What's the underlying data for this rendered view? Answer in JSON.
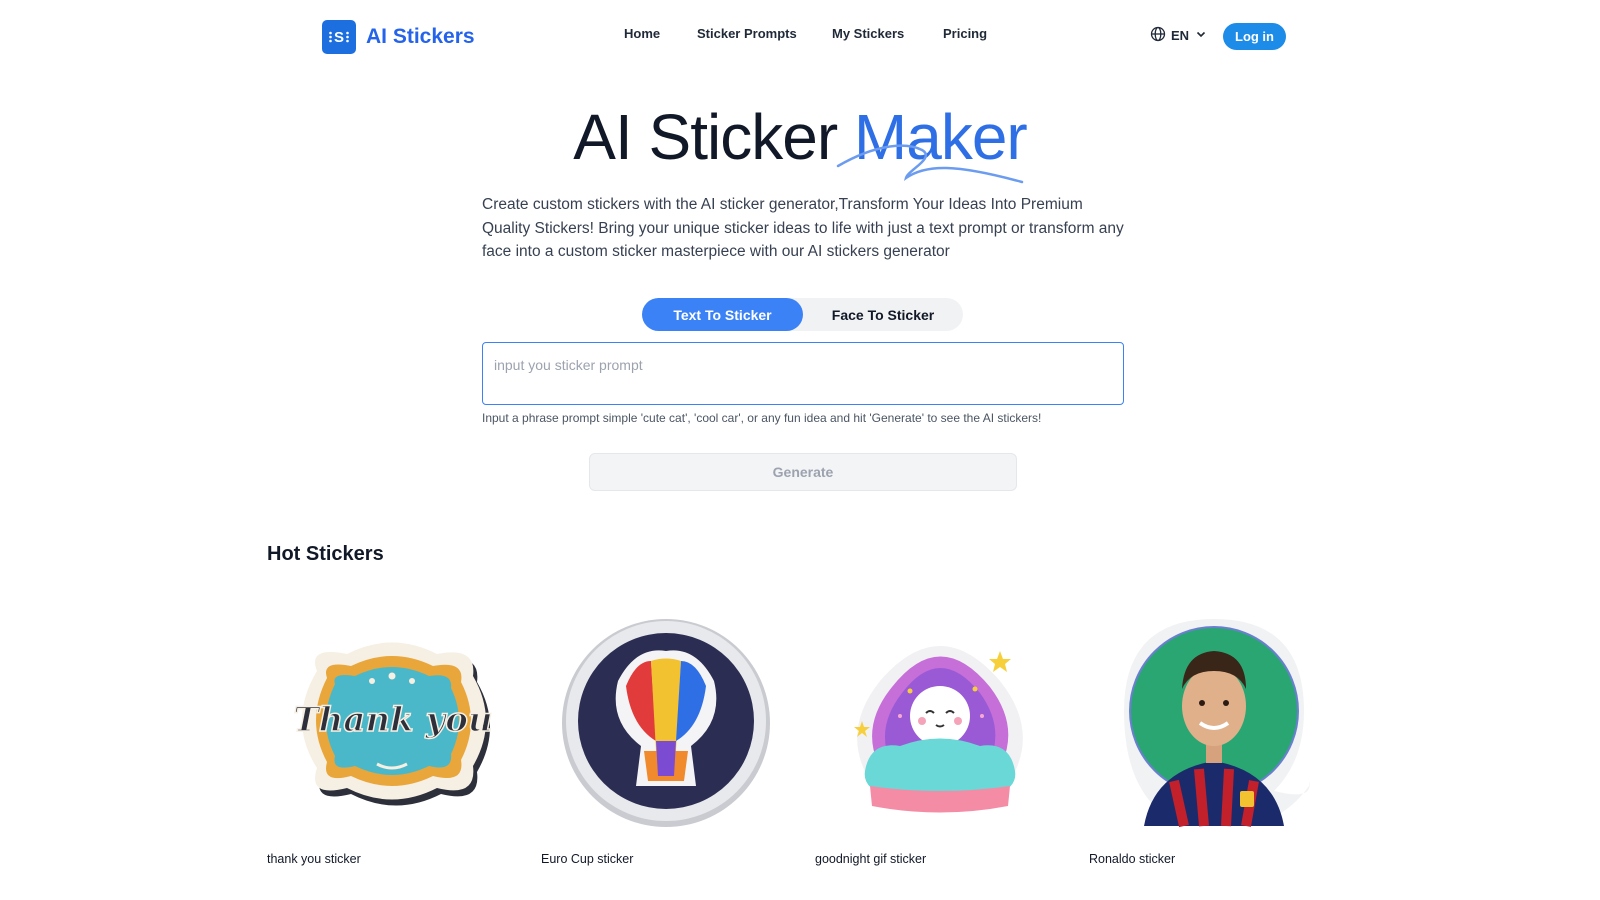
{
  "header": {
    "brand_name": "AI Stickers",
    "brand_icon": "sticker-logo-icon",
    "nav": {
      "home": "Home",
      "prompts": "Sticker Prompts",
      "my_stickers": "My Stickers",
      "pricing": "Pricing"
    },
    "language": "EN",
    "login": "Log in"
  },
  "hero": {
    "title_main": "AI Sticker ",
    "title_accent": "Maker",
    "description": "Create custom stickers with the AI sticker generator,Transform Your Ideas Into Premium Quality Stickers! Bring your unique sticker ideas to life with just a text prompt or transform any face into a custom sticker masterpiece with our AI stickers generator"
  },
  "tabs": {
    "text_to_sticker": "Text To Sticker",
    "face_to_sticker": "Face To Sticker",
    "active": "text_to_sticker"
  },
  "prompt": {
    "value": "",
    "placeholder": "input you sticker prompt",
    "hint": "Input a phrase prompt simple 'cute cat', 'cool car', or any fun idea and hit 'Generate' to see the AI stickers!"
  },
  "generate_label": "Generate",
  "hot_stickers": {
    "title": "Hot Stickers",
    "items": [
      {
        "label": "thank you sticker",
        "art_text": "Thank you"
      },
      {
        "label": "Euro Cup sticker"
      },
      {
        "label": "goodnight gif sticker"
      },
      {
        "label": "Ronaldo sticker"
      }
    ]
  },
  "colors": {
    "brand": "#2563eb",
    "accent": "#3b82f6",
    "login_bg": "#1d8be8"
  }
}
